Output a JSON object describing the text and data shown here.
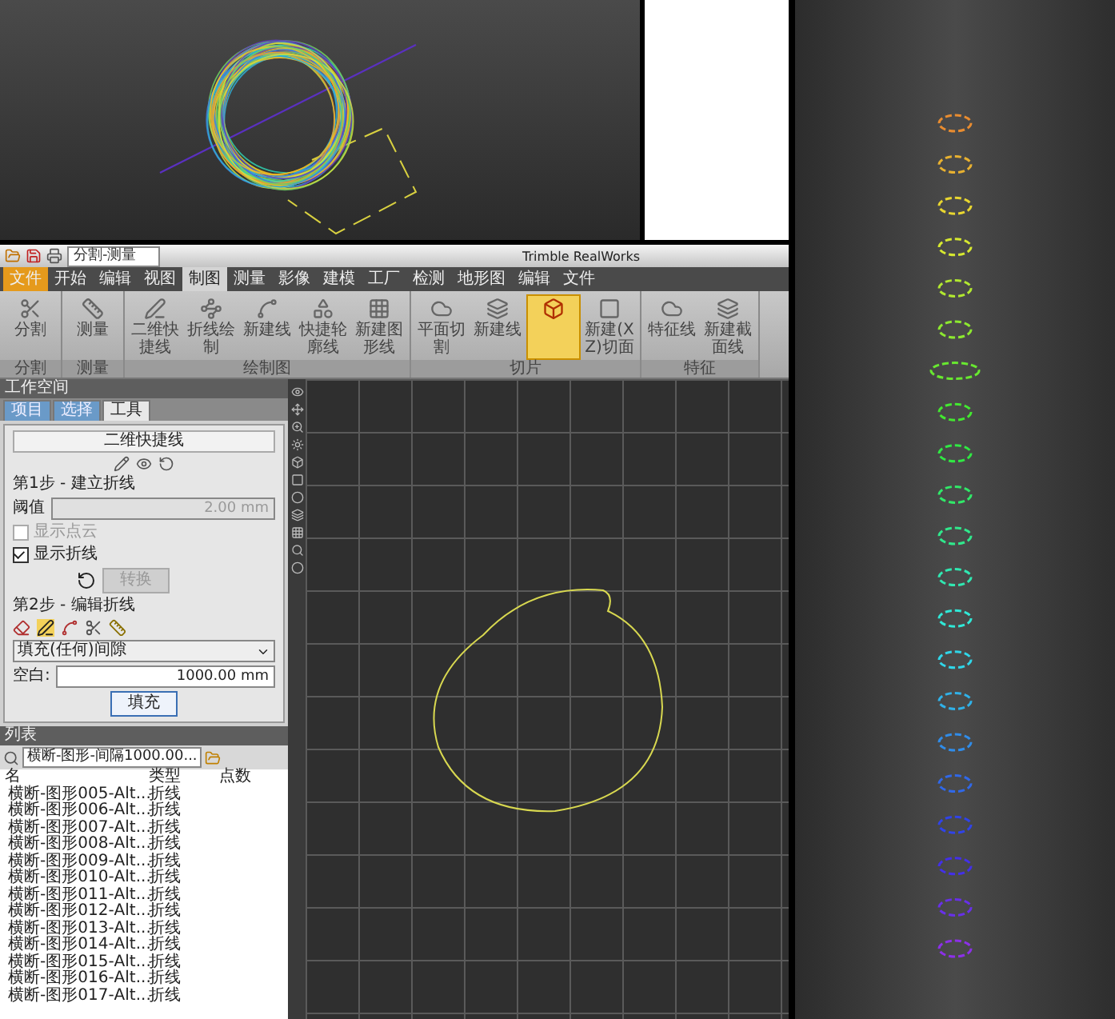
{
  "app": {
    "quick_access_field": "分割-测量",
    "title": "Trimble RealWorks",
    "tabs": [
      {
        "label": "文件",
        "kind": "file",
        "selected": false
      },
      {
        "label": "开始",
        "kind": "tab",
        "selected": false
      },
      {
        "label": "编辑",
        "kind": "tab",
        "selected": false
      },
      {
        "label": "视图",
        "kind": "tab",
        "selected": false
      },
      {
        "label": "制图",
        "kind": "tab",
        "selected": true
      },
      {
        "label": "测量",
        "kind": "tab",
        "selected": false
      },
      {
        "label": "影像",
        "kind": "tab",
        "selected": false
      },
      {
        "label": "建模",
        "kind": "tab",
        "selected": false
      },
      {
        "label": "工厂",
        "kind": "tab",
        "selected": false
      },
      {
        "label": "检测",
        "kind": "tab",
        "selected": false
      },
      {
        "label": "地形图",
        "kind": "tab",
        "selected": false
      },
      {
        "label": "编辑",
        "kind": "tab",
        "selected": false
      },
      {
        "label": "文件",
        "kind": "tab",
        "selected": false
      }
    ],
    "ribbon_groups": [
      {
        "label": "分割",
        "buttons": [
          {
            "label": "分割",
            "selected": false
          }
        ]
      },
      {
        "label": "测量",
        "buttons": [
          {
            "label": "测量",
            "selected": false
          }
        ]
      },
      {
        "label": "绘制图",
        "buttons": [
          {
            "label": "二维快捷线",
            "selected": false
          },
          {
            "label": "折线绘制",
            "selected": false
          },
          {
            "label": "新建线",
            "selected": false
          },
          {
            "label": "快捷轮廓线",
            "selected": false
          },
          {
            "label": "新建图形线",
            "selected": false
          }
        ]
      },
      {
        "label": "切片",
        "buttons": [
          {
            "label": "平面切割",
            "selected": false
          },
          {
            "label": "新建线",
            "selected": false
          },
          {
            "selected": true
          },
          {
            "label": "新建(XZ)切面",
            "selected": false
          }
        ]
      },
      {
        "label": "特征",
        "buttons": [
          {
            "label": "特征线",
            "selected": false
          },
          {
            "label": "新建截面线",
            "selected": false
          }
        ]
      }
    ]
  },
  "workspace": {
    "header": "工作空间",
    "tabs": [
      {
        "label": "项目",
        "selected": false
      },
      {
        "label": "选择",
        "selected": false
      },
      {
        "label": "工具",
        "selected": true
      }
    ],
    "tool_title": "二维快捷线",
    "step1": "第1步 - 建立折线",
    "threshold_label": "阈值",
    "threshold_value": "2.00 mm",
    "threshold_disabled": true,
    "options": [
      {
        "label": "显示点云",
        "checked": false,
        "disabled": true
      },
      {
        "label": "显示折线",
        "checked": true,
        "disabled": false
      }
    ],
    "convert_button": {
      "label": "转换",
      "disabled": true
    },
    "step2": "第2步 - 编辑折线",
    "fill_mode": "填充(任何)间隙",
    "gap_label": "空白:",
    "gap_value": "1000.00 mm",
    "fill_button": {
      "label": "填充",
      "disabled": false
    }
  },
  "list": {
    "header": "列表",
    "search_value": "横断-图形-间隔1000.00...",
    "columns": [
      "名",
      "类型",
      "点数"
    ],
    "rows": [
      {
        "name": "横断-图形005-Alt...",
        "type": "折线"
      },
      {
        "name": "横断-图形006-Alt...",
        "type": "折线"
      },
      {
        "name": "横断-图形007-Alt...",
        "type": "折线"
      },
      {
        "name": "横断-图形008-Alt...",
        "type": "折线"
      },
      {
        "name": "横断-图形009-Alt...",
        "type": "折线"
      },
      {
        "name": "横断-图形010-Alt...",
        "type": "折线"
      },
      {
        "name": "横断-图形011-Alt...",
        "type": "折线"
      },
      {
        "name": "横断-图形012-Alt...",
        "type": "折线"
      },
      {
        "name": "横断-图形013-Alt...",
        "type": "折线"
      },
      {
        "name": "横断-图形014-Alt...",
        "type": "折线"
      },
      {
        "name": "横断-图形015-Alt...",
        "type": "折线"
      },
      {
        "name": "横断-图形016-Alt...",
        "type": "折线"
      },
      {
        "name": "横断-图形017-Alt...",
        "type": "折线"
      }
    ]
  }
}
